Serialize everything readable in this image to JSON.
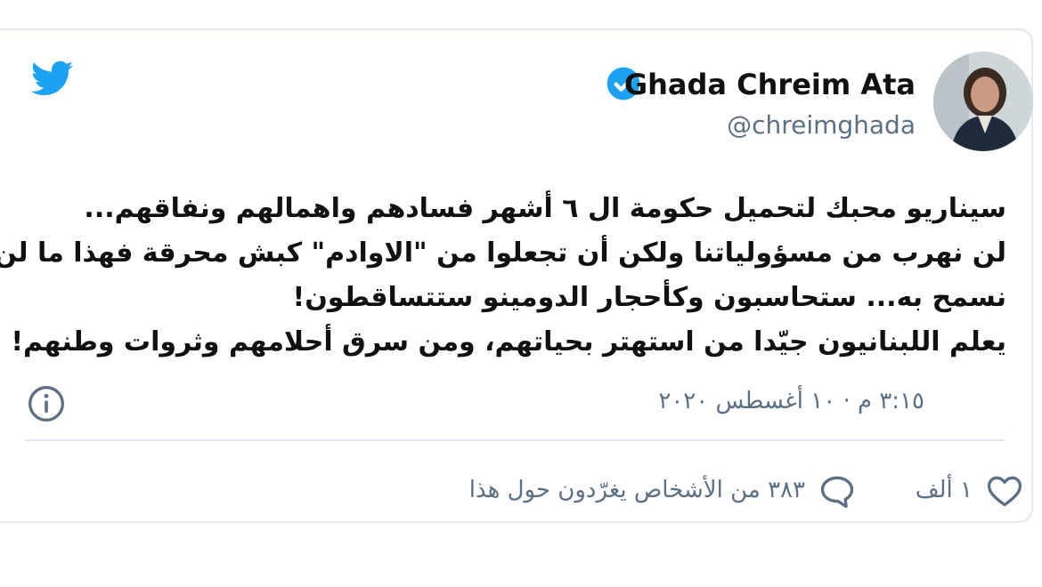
{
  "tweet": {
    "author": {
      "display_name": "Ghada Chreim Ata",
      "handle": "@chreimghada",
      "verified": true
    },
    "text_lines": [
      "سيناريو محبك لتحميل حكومة ال ٦ أشهر فسادهم واهمالهم ونفاقهم...",
      "لن نهرب من مسؤولياتنا ولكن أن تجعلوا من \"الاوادم\" كبش محرقة فهذا ما لن",
      "نسمح به... ستحاسبون وكأحجار الدومينو ستتساقطون!",
      "يعلم اللبنانيون جيّدا من استهتر بحياتهم، ومن سرق أحلامهم وثروات وطنهم!"
    ],
    "timestamp": "٣:١٥ م · ١٠ أغسطس ٢٠٢٠",
    "likes": "١ ألف",
    "replies_text": "٣٨٣ من الأشخاص يغرّدون حول هذا"
  },
  "icons": {
    "logo": "twitter-bird-icon",
    "verified": "verified-badge-icon",
    "info": "info-icon",
    "like": "heart-icon",
    "reply": "reply-bubble-icon"
  },
  "colors": {
    "brand": "#1da1f2",
    "text": "#111111",
    "secondary": "#5b7083",
    "border": "#e1e8ed",
    "like": "#5b7083"
  }
}
